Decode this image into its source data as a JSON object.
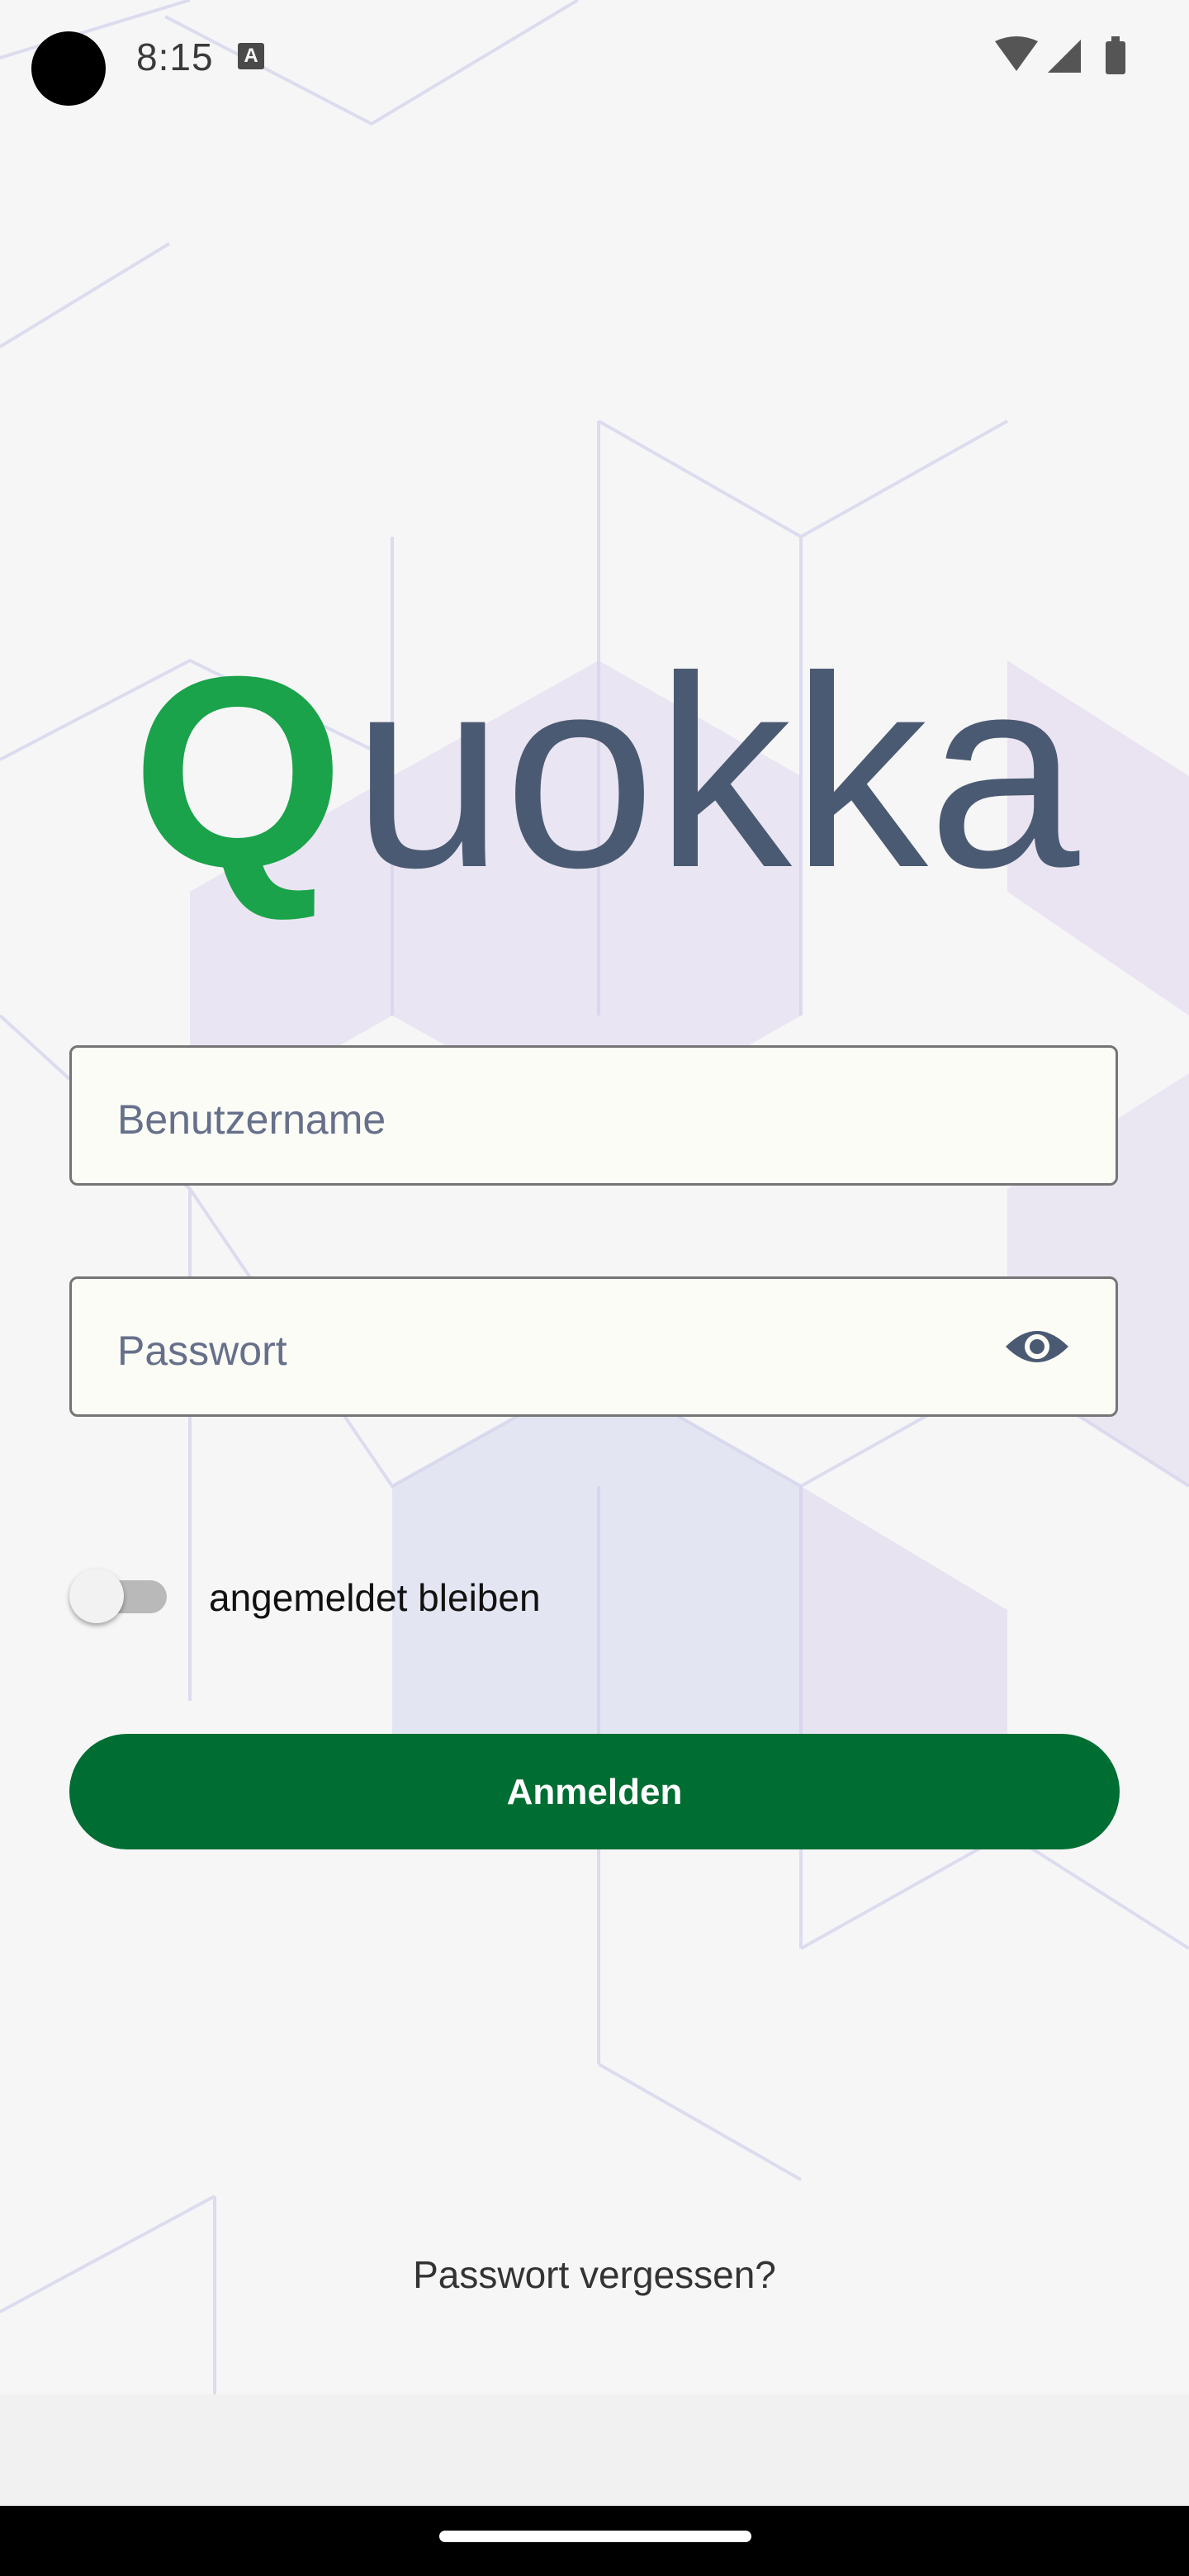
{
  "status_bar": {
    "time": "8:15",
    "notification_icon": "A"
  },
  "logo": {
    "first_letter": "Q",
    "rest": "uokka",
    "colors": {
      "first_letter": "#1aa34a",
      "rest": "#4a5a72"
    }
  },
  "form": {
    "username_placeholder": "Benutzername",
    "password_placeholder": "Passwort",
    "stay_signed_in_label": "angemeldet bleiben",
    "stay_signed_in_enabled": false,
    "login_button_label": "Anmelden"
  },
  "footer": {
    "forgot_password_link": "Passwort vergessen?"
  },
  "icons": {
    "visibility": "eye-icon",
    "wifi": "wifi-icon",
    "signal": "signal-icon",
    "battery": "battery-icon"
  },
  "colors": {
    "primary": "#006d32",
    "background": "#f6f6f7"
  }
}
